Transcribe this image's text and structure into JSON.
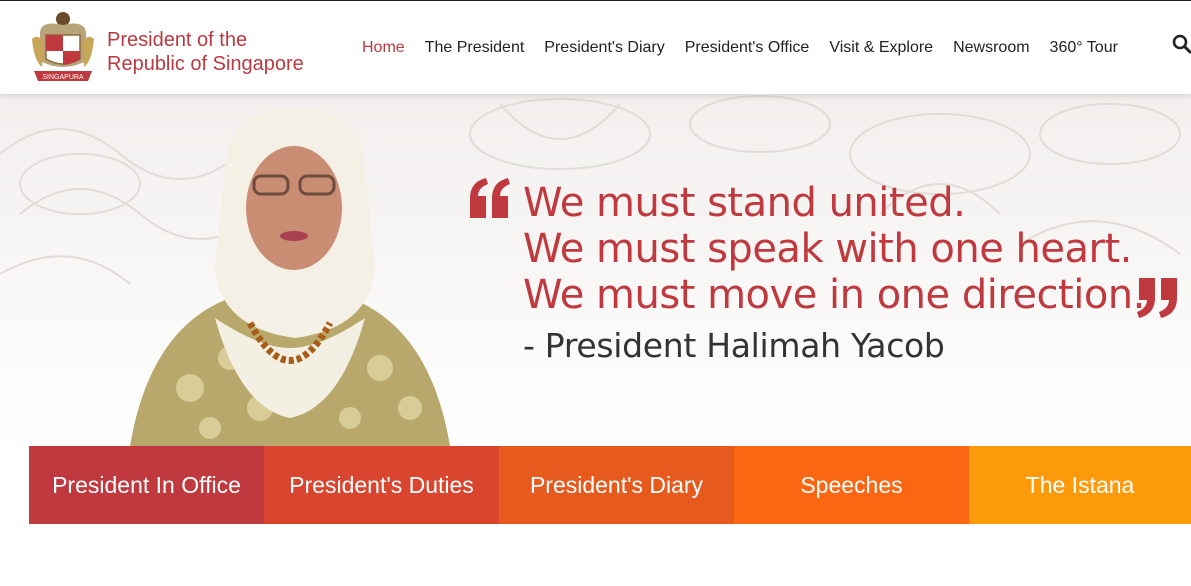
{
  "brand": {
    "line1": "President of the",
    "line2": "Republic of Singapore",
    "crest_banner": "SINGAPURA",
    "color": "#b83a3f"
  },
  "nav": {
    "items": [
      {
        "label": "Home",
        "active": true
      },
      {
        "label": "The President",
        "active": false
      },
      {
        "label": "President's Diary",
        "active": false
      },
      {
        "label": "President's Office",
        "active": false
      },
      {
        "label": "Visit & Explore",
        "active": false
      },
      {
        "label": "Newsroom",
        "active": false
      },
      {
        "label": "360° Tour",
        "active": false
      }
    ],
    "search_icon": "search-icon"
  },
  "hero": {
    "quote_lines": [
      "We must stand united.",
      "We must speak with one heart.",
      "We must move in one direction."
    ],
    "attribution": "- President Halimah Yacob",
    "quote_color": "#c0393f"
  },
  "tiles": [
    {
      "label": "President In Office",
      "color": "#c0393f"
    },
    {
      "label": "President's Duties",
      "color": "#d9452e"
    },
    {
      "label": "President's Diary",
      "color": "#e65a1e"
    },
    {
      "label": "Speeches",
      "color": "#fb6612"
    },
    {
      "label": "The Istana",
      "color": "#fd9a0a"
    }
  ]
}
